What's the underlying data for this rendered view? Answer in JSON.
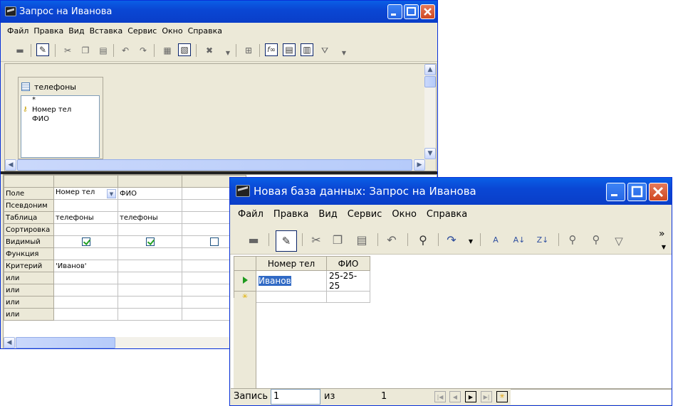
{
  "back_window": {
    "title": "Запрос на Иванова",
    "menu": [
      "Файл",
      "Правка",
      "Вид",
      "Вставка",
      "Сервис",
      "Окно",
      "Справка"
    ],
    "table_box": {
      "title": "телефоны",
      "fields": [
        "*",
        "Номер тел",
        "ФИО"
      ]
    },
    "row_labels": [
      "Поле",
      "Псевдоним",
      "Таблица",
      "Сортировка",
      "Видимый",
      "Функция",
      "Критерий",
      "или",
      "или",
      "или",
      "или"
    ],
    "columns": [
      {
        "field": "Номер тел",
        "table": "телефоны",
        "visible": true,
        "criteria": "'Иванов'"
      },
      {
        "field": "ФИО",
        "table": "телефоны",
        "visible": true,
        "criteria": ""
      },
      {
        "field": "",
        "table": "",
        "visible": false,
        "criteria": ""
      }
    ]
  },
  "front_window": {
    "title": "Новая база данных: Запрос на Иванова",
    "menu": [
      "Файл",
      "Правка",
      "Вид",
      "Сервис",
      "Окно",
      "Справка"
    ],
    "headers": [
      "Номер тел",
      "ФИО"
    ],
    "row": [
      "Иванов",
      "25-25-25"
    ],
    "nav": {
      "label": "Запись",
      "current": "1",
      "of": "из",
      "total": "1"
    },
    "overflow": "»"
  },
  "colors": {
    "titlebar": "#0a47d4",
    "face": "#ece9d8",
    "selection": "#316ac5"
  }
}
